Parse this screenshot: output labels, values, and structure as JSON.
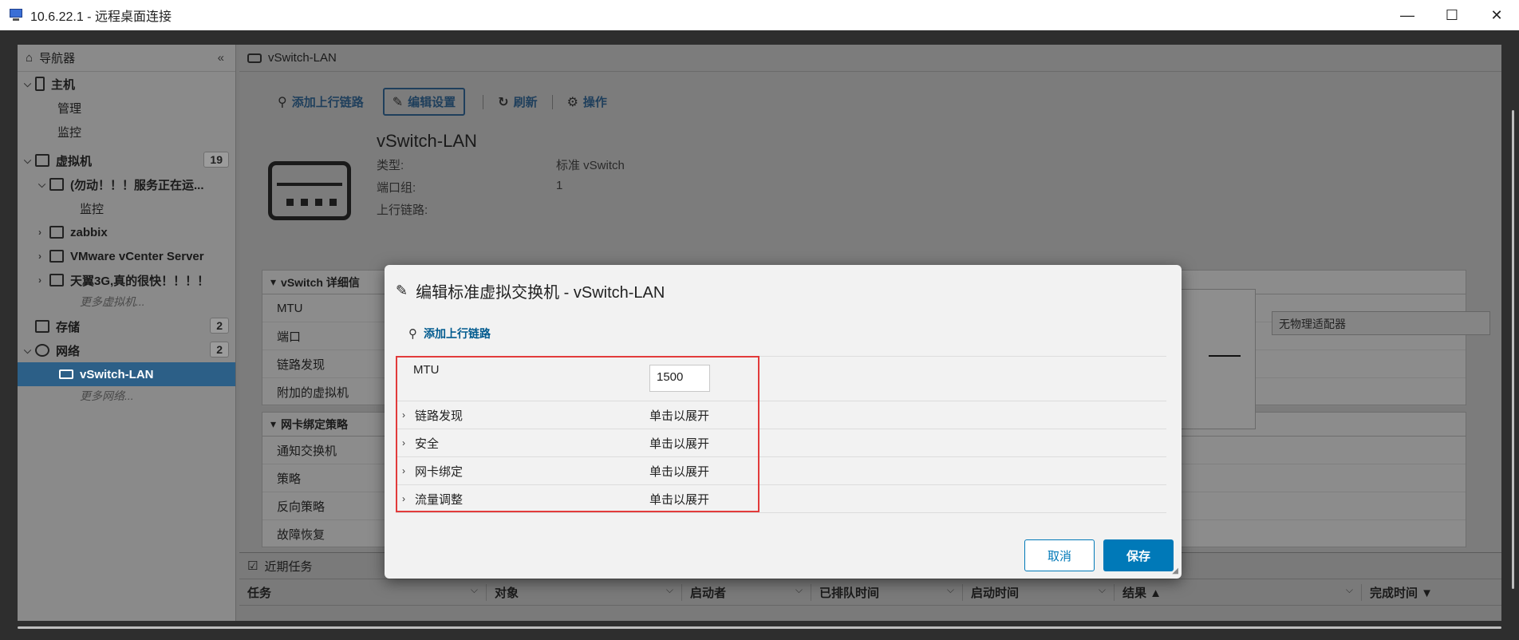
{
  "window": {
    "title": "10.6.22.1 - 远程桌面连接",
    "minimize": "—",
    "maximize": "☐",
    "close": "✕"
  },
  "nav": {
    "title": "导航器",
    "collapse": "«",
    "host": {
      "label": "主机",
      "children": [
        "管理",
        "监控"
      ]
    },
    "vms": {
      "label": "虚拟机",
      "count": "19",
      "items": [
        {
          "label": "(勿动！！！服务正在运...",
          "child": "监控"
        },
        {
          "label": "zabbix"
        },
        {
          "label": "VMware vCenter Server"
        },
        {
          "label": "天翼3G,真的很快！！！！"
        }
      ],
      "more": "更多虚拟机..."
    },
    "storage": {
      "label": "存储",
      "count": "2"
    },
    "network": {
      "label": "网络",
      "count": "2",
      "selected": "vSwitch-LAN",
      "more": "更多网络..."
    }
  },
  "main": {
    "breadcrumb": "vSwitch-LAN",
    "toolbar": {
      "add_uplink": "添加上行链路",
      "edit_settings": "编辑设置",
      "refresh": "刷新",
      "actions": "操作"
    },
    "switch_name": "vSwitch-LAN",
    "props": [
      {
        "k": "类型:",
        "v": "标准 vSwitch"
      },
      {
        "k": "端口组:",
        "v": "1"
      },
      {
        "k": "上行链路:",
        "v": ""
      }
    ],
    "details_panel": {
      "title": "vSwitch 详细信",
      "rows": [
        "MTU",
        "端口",
        "链路发现",
        "附加的虚拟机"
      ]
    },
    "nic_panel": {
      "title": "网卡绑定策略",
      "rows": [
        "通知交换机",
        "策略",
        "反向策略",
        "故障恢复"
      ]
    },
    "no_physical": "无物理适配器",
    "recent_tasks": {
      "title": "近期任务",
      "columns": [
        "任务",
        "对象",
        "启动者",
        "已排队时间",
        "启动时间",
        "结果 ▲",
        "完成时间 ▼"
      ]
    }
  },
  "modal": {
    "title": "编辑标准虚拟交换机 - vSwitch-LAN",
    "add_uplink": "添加上行链路",
    "mtu_label": "MTU",
    "mtu_value": "1500",
    "sections": [
      {
        "label": "链路发现",
        "value": "单击以展开"
      },
      {
        "label": "安全",
        "value": "单击以展开"
      },
      {
        "label": "网卡绑定",
        "value": "单击以展开"
      },
      {
        "label": "流量调整",
        "value": "单击以展开"
      }
    ],
    "cancel": "取消",
    "save": "保存"
  },
  "colors": {
    "accent": "#0079b8",
    "highlight_box": "#e23b3b",
    "selected_nav": "#2c5f87"
  }
}
